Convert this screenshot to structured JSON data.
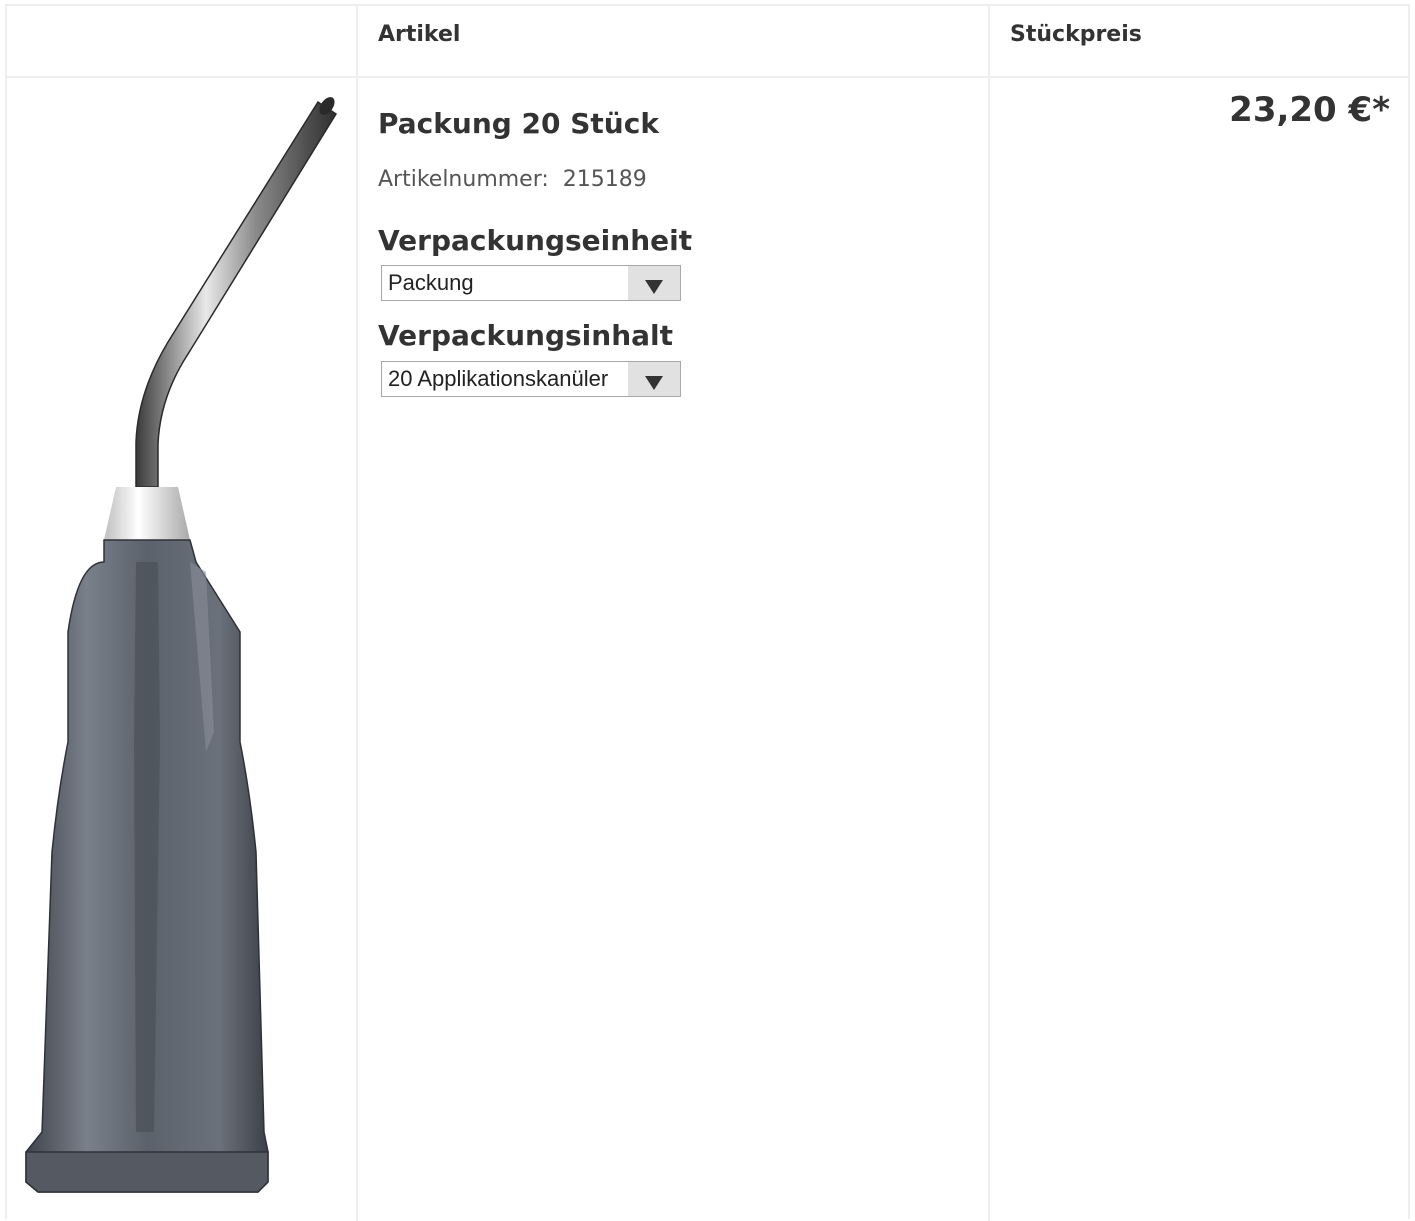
{
  "table": {
    "headers": {
      "image": "",
      "article": "Artikel",
      "unit_price": "Stückpreis"
    }
  },
  "product": {
    "title": "Packung 20 Stück",
    "article_number_label": "Artikelnummer:",
    "article_number": "215189",
    "packaging_unit": {
      "label": "Verpackungseinheit",
      "selected": "Packung"
    },
    "packaging_content": {
      "label": "Verpackungsinhalt",
      "selected": "20 Applikationskanüler"
    },
    "price": "23,20 €*",
    "image_icon": "dispensing-cannula-image"
  },
  "colors": {
    "border": "#eeeeee",
    "text": "#333333",
    "cannula_body": "#5c626b"
  }
}
